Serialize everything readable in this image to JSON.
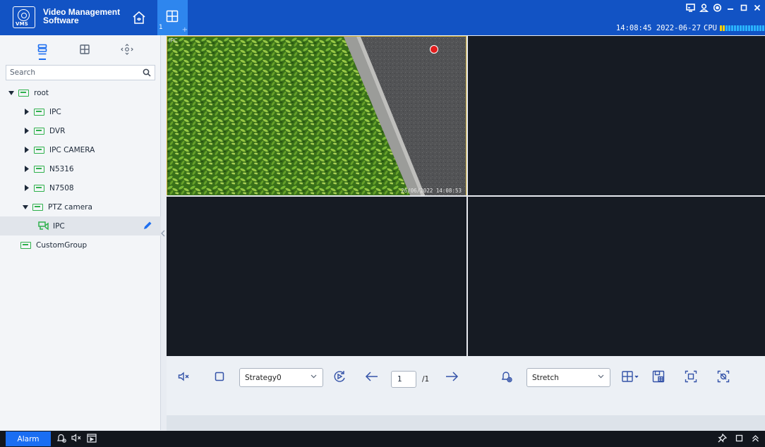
{
  "app": {
    "name_line1": "Video Management",
    "name_line2": "Software",
    "logo_text": "VMS"
  },
  "tabs": [
    {
      "number": "1",
      "plus": "+"
    }
  ],
  "status": {
    "time": "14:08:45 2022-06-27",
    "cpu_label": "CPU"
  },
  "sidebar": {
    "search_placeholder": "Search",
    "tree": [
      {
        "label": "root",
        "level": 0,
        "expanded": true
      },
      {
        "label": "IPC",
        "level": 1,
        "expanded": false
      },
      {
        "label": "DVR",
        "level": 1,
        "expanded": false
      },
      {
        "label": "IPC CAMERA",
        "level": 1,
        "expanded": false
      },
      {
        "label": "N5316",
        "level": 1,
        "expanded": false
      },
      {
        "label": "N7508",
        "level": 1,
        "expanded": false
      },
      {
        "label": "PTZ camera",
        "level": 1,
        "expanded": true
      },
      {
        "label": "IPC",
        "level": 2,
        "selected": true
      },
      {
        "label": "CustomGroup",
        "level": 0
      }
    ]
  },
  "video": {
    "cell1_label": "IPC",
    "cell1_timestamp": "26/06/2022 14:08:53"
  },
  "toolbar": {
    "strategy_value": "Strategy0",
    "page_current": "1",
    "page_total": "/1",
    "stretch_value": "Stretch"
  },
  "statusbar": {
    "alarm_label": "Alarm"
  },
  "colors": {
    "titlebar": "#1253c4",
    "active_tab": "#2e86ee",
    "accent": "#1e6ff0",
    "tree_icon": "#2fb14c",
    "selected_frame": "#d2b33d",
    "record": "#e21d1d"
  }
}
